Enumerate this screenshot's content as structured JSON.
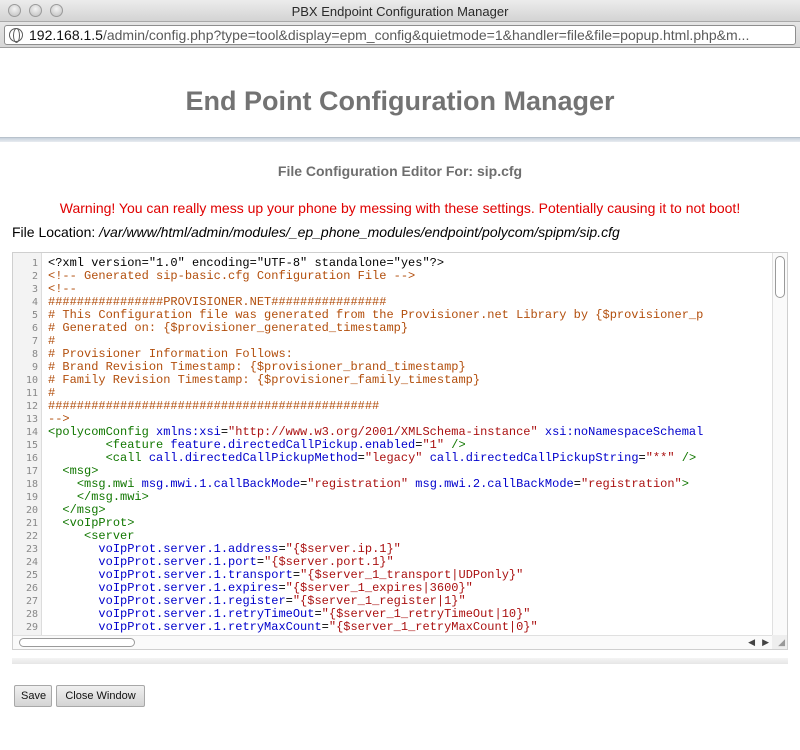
{
  "window": {
    "title": "PBX Endpoint Configuration Manager"
  },
  "browser": {
    "url_host": "192.168.1.5",
    "url_path": "/admin/config.php?type=tool&display=epm_config&quietmode=1&handler=file&file=popup.html.php&m..."
  },
  "page": {
    "title": "End Point Configuration Manager",
    "editor_heading": "File Configuration Editor For: sip.cfg",
    "warning": "Warning! You can really mess up your phone by messing with these settings. Potentially causing it to not boot!",
    "file_location_label": "File Location:",
    "file_location_path": "/var/www/html/admin/modules/_ep_phone_modules/endpoint/polycom/spipm/sip.cfg"
  },
  "editor": {
    "line_numbers": [
      "1",
      "2",
      "3",
      "4",
      "5",
      "6",
      "7",
      "8",
      "9",
      "10",
      "11",
      "12",
      "13",
      "14",
      "15",
      "16",
      "17",
      "18",
      "19",
      "20",
      "21",
      "22",
      "23",
      "24",
      "25",
      "26",
      "27",
      "28",
      "29"
    ],
    "lines": [
      [
        [
          "pi",
          "<?xml version=\"1.0\" encoding=\"UTF-8\" standalone=\"yes\"?>"
        ]
      ],
      [
        [
          "cm",
          "<!-- Generated sip-basic.cfg Configuration File -->"
        ]
      ],
      [
        [
          "cm",
          "<!--"
        ]
      ],
      [
        [
          "cm",
          "################PROVISIONER.NET################"
        ]
      ],
      [
        [
          "cm",
          "# This Configuration file was generated from the Provisioner.net Library by {$provisioner_p"
        ]
      ],
      [
        [
          "cm",
          "# Generated on: {$provisioner_generated_timestamp}"
        ]
      ],
      [
        [
          "cm",
          "#"
        ]
      ],
      [
        [
          "cm",
          "# Provisioner Information Follows:"
        ]
      ],
      [
        [
          "cm",
          "# Brand Revision Timestamp: {$provisioner_brand_timestamp}"
        ]
      ],
      [
        [
          "cm",
          "# Family Revision Timestamp: {$provisioner_family_timestamp}"
        ]
      ],
      [
        [
          "cm",
          "#"
        ]
      ],
      [
        [
          "cm",
          "##############################################"
        ]
      ],
      [
        [
          "cm",
          "-->"
        ]
      ],
      [
        [
          "tag",
          "<polycomConfig"
        ],
        [
          "txt",
          " "
        ],
        [
          "attr",
          "xmlns:xsi"
        ],
        [
          "txt",
          "="
        ],
        [
          "val",
          "\"http://www.w3.org/2001/XMLSchema-instance\""
        ],
        [
          "txt",
          " "
        ],
        [
          "attr",
          "xsi:noNamespaceSchemal"
        ]
      ],
      [
        [
          "txt",
          "        "
        ],
        [
          "tag",
          "<feature"
        ],
        [
          "txt",
          " "
        ],
        [
          "attr",
          "feature.directedCallPickup.enabled"
        ],
        [
          "txt",
          "="
        ],
        [
          "val",
          "\"1\""
        ],
        [
          "txt",
          " "
        ],
        [
          "tag",
          "/>"
        ]
      ],
      [
        [
          "txt",
          "        "
        ],
        [
          "tag",
          "<call"
        ],
        [
          "txt",
          " "
        ],
        [
          "attr",
          "call.directedCallPickupMethod"
        ],
        [
          "txt",
          "="
        ],
        [
          "val",
          "\"legacy\""
        ],
        [
          "txt",
          " "
        ],
        [
          "attr",
          "call.directedCallPickupString"
        ],
        [
          "txt",
          "="
        ],
        [
          "val",
          "\"**\""
        ],
        [
          "txt",
          " "
        ],
        [
          "tag",
          "/>"
        ]
      ],
      [
        [
          "txt",
          "  "
        ],
        [
          "tag",
          "<msg>"
        ]
      ],
      [
        [
          "txt",
          "    "
        ],
        [
          "tag",
          "<msg.mwi"
        ],
        [
          "txt",
          " "
        ],
        [
          "attr",
          "msg.mwi.1.callBackMode"
        ],
        [
          "txt",
          "="
        ],
        [
          "val",
          "\"registration\""
        ],
        [
          "txt",
          " "
        ],
        [
          "attr",
          "msg.mwi.2.callBackMode"
        ],
        [
          "txt",
          "="
        ],
        [
          "val",
          "\"registration\""
        ],
        [
          "tag",
          ">"
        ]
      ],
      [
        [
          "txt",
          "    "
        ],
        [
          "tag",
          "</msg.mwi>"
        ]
      ],
      [
        [
          "txt",
          "  "
        ],
        [
          "tag",
          "</msg>"
        ]
      ],
      [
        [
          "txt",
          "  "
        ],
        [
          "tag",
          "<voIpProt>"
        ]
      ],
      [
        [
          "txt",
          "     "
        ],
        [
          "tag",
          "<server"
        ]
      ],
      [
        [
          "txt",
          "       "
        ],
        [
          "attr",
          "voIpProt.server.1.address"
        ],
        [
          "txt",
          "="
        ],
        [
          "val",
          "\"{$server.ip.1}\""
        ]
      ],
      [
        [
          "txt",
          "       "
        ],
        [
          "attr",
          "voIpProt.server.1.port"
        ],
        [
          "txt",
          "="
        ],
        [
          "val",
          "\"{$server.port.1}\""
        ]
      ],
      [
        [
          "txt",
          "       "
        ],
        [
          "attr",
          "voIpProt.server.1.transport"
        ],
        [
          "txt",
          "="
        ],
        [
          "val",
          "\"{$server_1_transport|UDPonly}\""
        ]
      ],
      [
        [
          "txt",
          "       "
        ],
        [
          "attr",
          "voIpProt.server.1.expires"
        ],
        [
          "txt",
          "="
        ],
        [
          "val",
          "\"{$server_1_expires|3600}\""
        ]
      ],
      [
        [
          "txt",
          "       "
        ],
        [
          "attr",
          "voIpProt.server.1.register"
        ],
        [
          "txt",
          "="
        ],
        [
          "val",
          "\"{$server_1_register|1}\""
        ]
      ],
      [
        [
          "txt",
          "       "
        ],
        [
          "attr",
          "voIpProt.server.1.retryTimeOut"
        ],
        [
          "txt",
          "="
        ],
        [
          "val",
          "\"{$server_1_retryTimeOut|10}\""
        ]
      ],
      [
        [
          "txt",
          "       "
        ],
        [
          "attr",
          "voIpProt.server.1.retryMaxCount"
        ],
        [
          "txt",
          "="
        ],
        [
          "val",
          "\"{$server_1_retryMaxCount|0}\""
        ]
      ]
    ]
  },
  "buttons": {
    "save": "Save",
    "close": "Close Window"
  }
}
